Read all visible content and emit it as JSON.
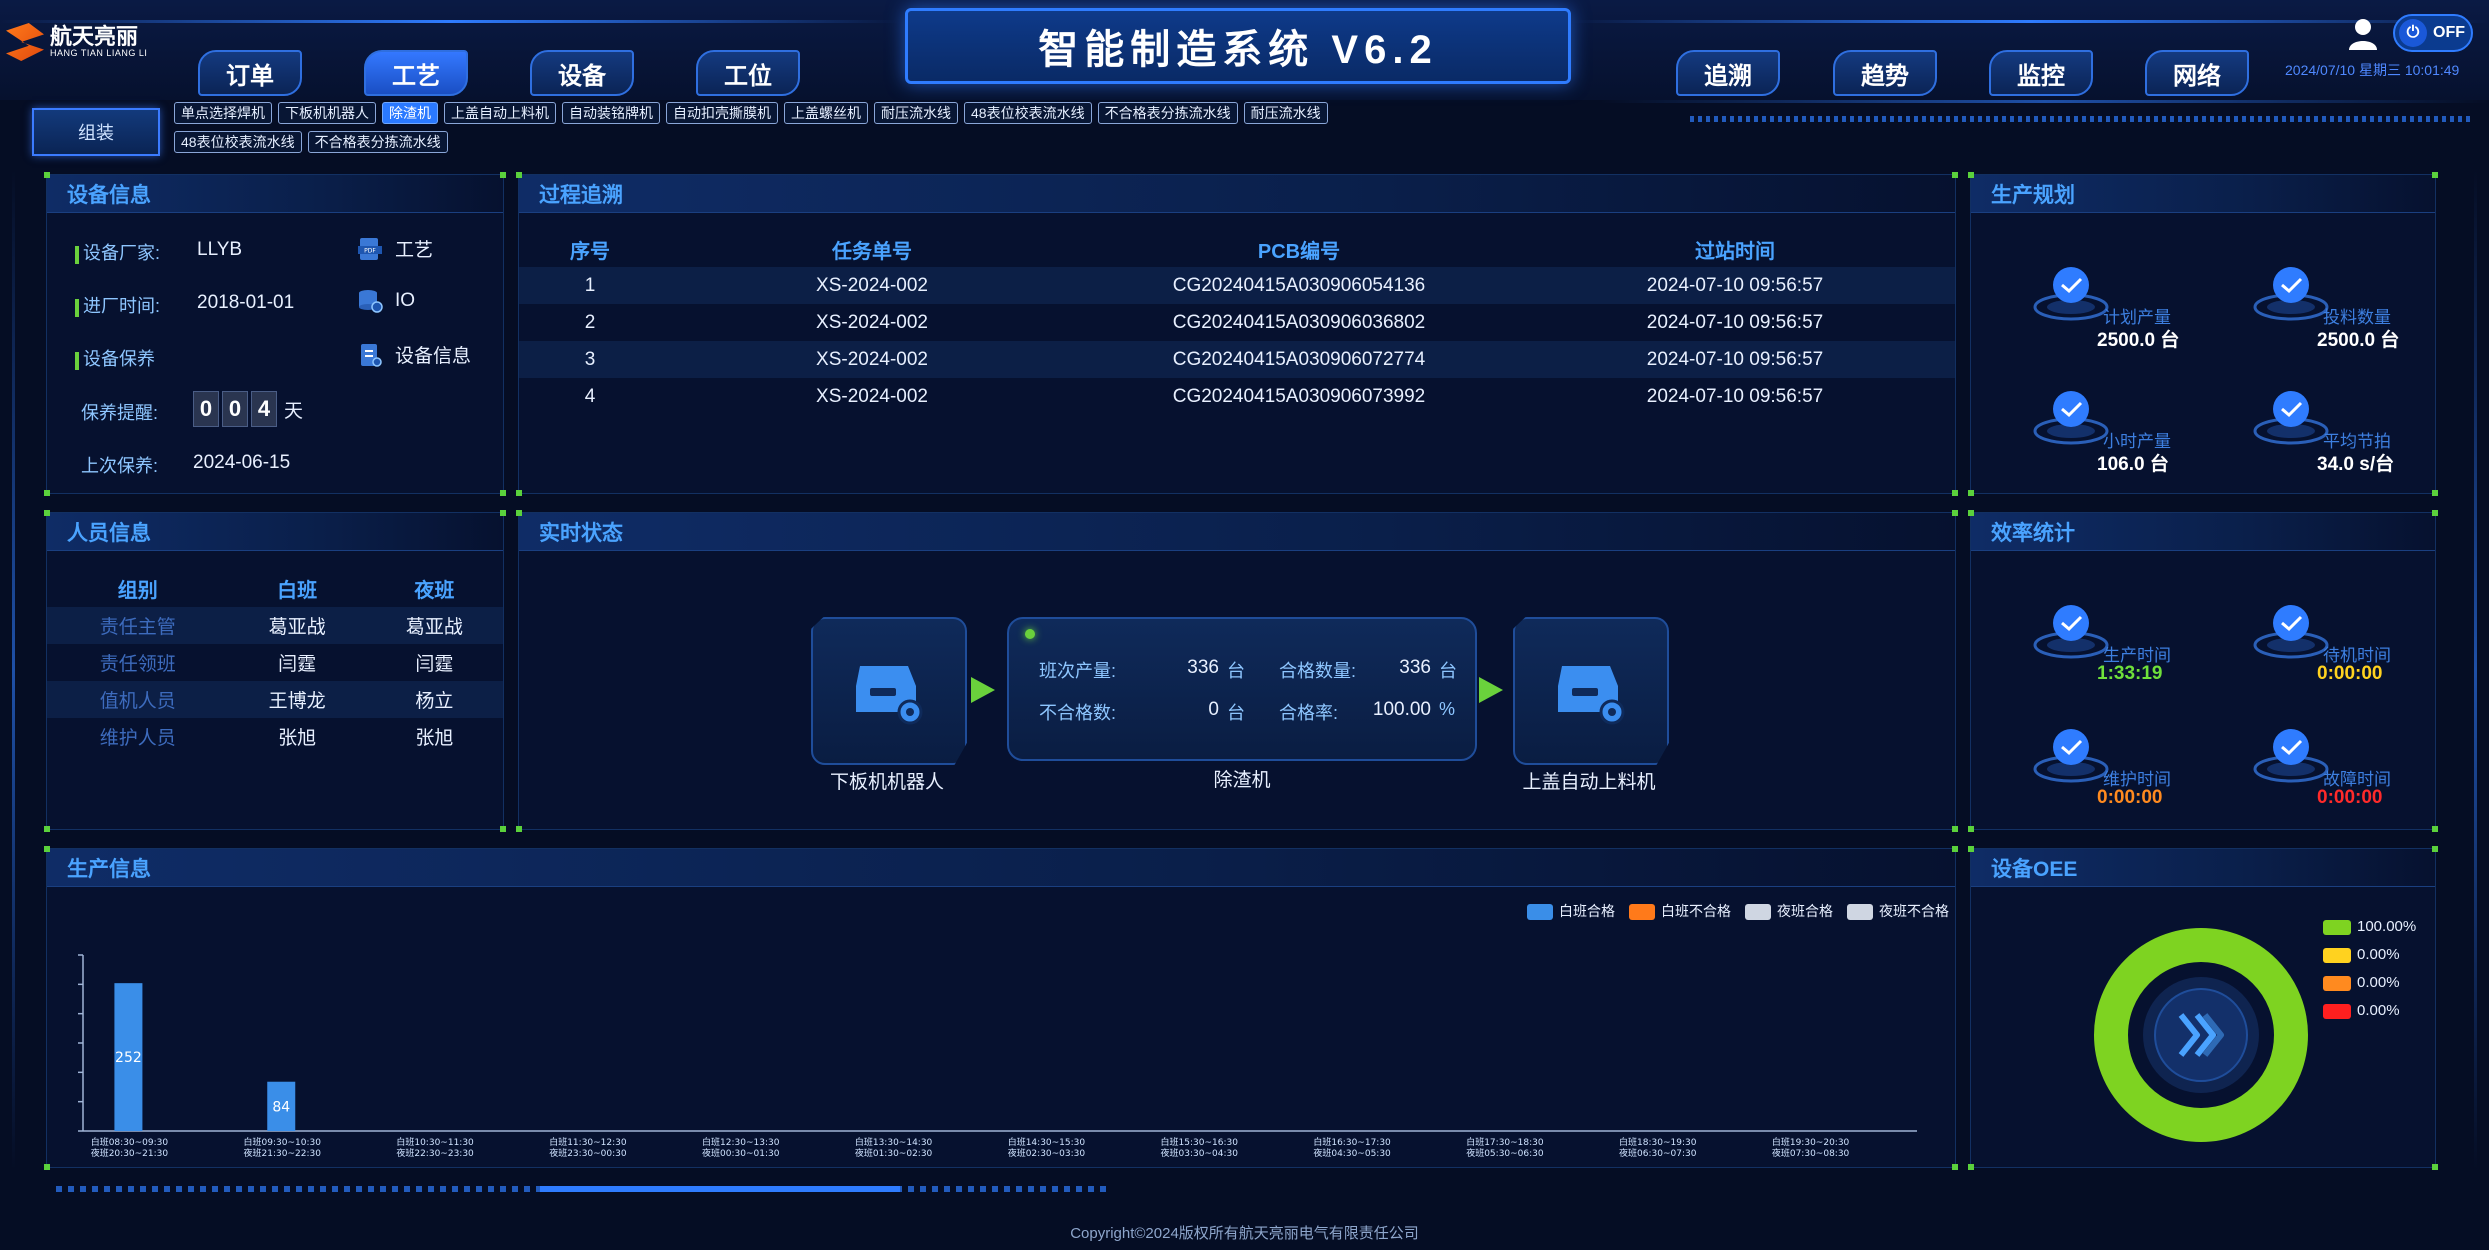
{
  "header": {
    "title": "智能制造系统 V6.2",
    "logo_text": "航天亮丽",
    "logo_sub": "HANG TIAN LIANG LI",
    "datetime": "2024/07/10 星期三 10:01:49",
    "toggle_label": "OFF",
    "nav_left": [
      "订单",
      "工艺",
      "设备",
      "工位"
    ],
    "nav_right": [
      "追溯",
      "趋势",
      "监控",
      "网络"
    ]
  },
  "subnav": {
    "group_label": "组装",
    "chips_row1": [
      "单点选择焊机",
      "下板机机器人",
      "除渣机",
      "上盖自动上料机",
      "自动装铭牌机",
      "自动扣壳撕膜机",
      "上盖螺丝机",
      "耐压流水线",
      "48表位校表流水线",
      "不合格表分拣流水线",
      "耐压流水线"
    ],
    "chips_row2": [
      "48表位校表流水线",
      "不合格表分拣流水线"
    ]
  },
  "device_info": {
    "title": "设备信息",
    "manufacturer_label": "设备厂家:",
    "manufacturer": "LLYB",
    "entry_label": "进厂时间:",
    "entry_date": "2018-01-01",
    "maintain_label": "设备保养",
    "remind_label": "保养提醒:",
    "remind_digits": [
      "0",
      "0",
      "4"
    ],
    "remind_unit": "天",
    "last_label": "上次保养:",
    "last_date": "2024-06-15",
    "links": [
      "工艺",
      "IO",
      "设备信息"
    ]
  },
  "trace": {
    "title": "过程追溯",
    "headers": [
      "序号",
      "任务单号",
      "PCB编号",
      "过站时间"
    ],
    "rows": [
      [
        "1",
        "XS-2024-002",
        "CG20240415A030906054136",
        "2024-07-10 09:56:57"
      ],
      [
        "2",
        "XS-2024-002",
        "CG20240415A030906036802",
        "2024-07-10 09:56:57"
      ],
      [
        "3",
        "XS-2024-002",
        "CG20240415A030906072774",
        "2024-07-10 09:56:57"
      ],
      [
        "4",
        "XS-2024-002",
        "CG20240415A030906073992",
        "2024-07-10 09:56:57"
      ]
    ]
  },
  "plan": {
    "title": "生产规划",
    "items": [
      {
        "label": "计划产量",
        "value": "2500.0 台"
      },
      {
        "label": "投料数量",
        "value": "2500.0 台"
      },
      {
        "label": "小时产量",
        "value": "106.0 台"
      },
      {
        "label": "平均节拍",
        "value": "34.0 s/台"
      }
    ]
  },
  "people": {
    "title": "人员信息",
    "headers": [
      "组别",
      "白班",
      "夜班"
    ],
    "rows": [
      [
        "责任主管",
        "葛亚战",
        "葛亚战"
      ],
      [
        "责任领班",
        "闫霆",
        "闫霆"
      ],
      [
        "值机人员",
        "王博龙",
        "杨立"
      ],
      [
        "维护人员",
        "张旭",
        "张旭"
      ]
    ]
  },
  "realtime": {
    "title": "实时状态",
    "prev_machine": "下板机机器人",
    "current_machine": "除渣机",
    "next_machine": "上盖自动上料机",
    "shift_output_label": "班次产量:",
    "shift_output": "336",
    "pass_qty_label": "合格数量:",
    "pass_qty": "336",
    "fail_qty_label": "不合格数:",
    "fail_qty": "0",
    "pass_rate_label": "合格率:",
    "pass_rate": "100.00",
    "unit_tai": "台",
    "unit_pct": "%"
  },
  "efficiency": {
    "title": "效率统计",
    "items": [
      {
        "label": "生产时间",
        "value": "1:33:19",
        "color": "#6fe03a"
      },
      {
        "label": "待机时间",
        "value": "0:00:00",
        "color": "#ffd21f"
      },
      {
        "label": "维护时间",
        "value": "0:00:00",
        "color": "#ff8a1f"
      },
      {
        "label": "故障时间",
        "value": "0:00:00",
        "color": "#ff2a2a"
      }
    ]
  },
  "production": {
    "title": "生产信息",
    "legend": [
      {
        "name": "白班合格",
        "color": "#3a8ee8"
      },
      {
        "name": "白班不合格",
        "color": "#ff7a1a"
      },
      {
        "name": "夜班合格",
        "color": "#cfd6e2"
      },
      {
        "name": "夜班不合格",
        "color": "#cfd6e2"
      }
    ]
  },
  "chart_data": {
    "type": "bar",
    "categories_day": [
      "白班08:30~09:30",
      "白班09:30~10:30",
      "白班10:30~11:30",
      "白班11:30~12:30",
      "白班12:30~13:30",
      "白班13:30~14:30",
      "白班14:30~15:30",
      "白班15:30~16:30",
      "白班16:30~17:30",
      "白班17:30~18:30",
      "白班18:30~19:30",
      "白班19:30~20:30"
    ],
    "categories_night": [
      "夜班20:30~21:30",
      "夜班21:30~22:30",
      "夜班22:30~23:30",
      "夜班23:30~00:30",
      "夜班00:30~01:30",
      "夜班01:30~02:30",
      "夜班02:30~03:30",
      "夜班03:30~04:30",
      "夜班04:30~05:30",
      "夜班05:30~06:30",
      "夜班06:30~07:30",
      "夜班07:30~08:30"
    ],
    "series": [
      {
        "name": "白班合格",
        "values": [
          252,
          84,
          0,
          0,
          0,
          0,
          0,
          0,
          0,
          0,
          0,
          0
        ]
      },
      {
        "name": "白班不合格",
        "values": [
          0,
          0,
          0,
          0,
          0,
          0,
          0,
          0,
          0,
          0,
          0,
          0
        ]
      },
      {
        "name": "夜班合格",
        "values": [
          0,
          0,
          0,
          0,
          0,
          0,
          0,
          0,
          0,
          0,
          0,
          0
        ]
      },
      {
        "name": "夜班不合格",
        "values": [
          0,
          0,
          0,
          0,
          0,
          0,
          0,
          0,
          0,
          0,
          0,
          0
        ]
      }
    ],
    "ylim": [
      0,
      300
    ]
  },
  "oee": {
    "title": "设备OEE",
    "legend": [
      {
        "value": "100.00%",
        "color": "#7ed321"
      },
      {
        "value": "0.00%",
        "color": "#ffd21f"
      },
      {
        "value": "0.00%",
        "color": "#ff8a1f"
      },
      {
        "value": "0.00%",
        "color": "#ff1f1f"
      }
    ],
    "fractions": [
      1.0,
      0,
      0,
      0
    ]
  },
  "footer": "Copyright©2024版权所有航天亮丽电气有限责任公司"
}
